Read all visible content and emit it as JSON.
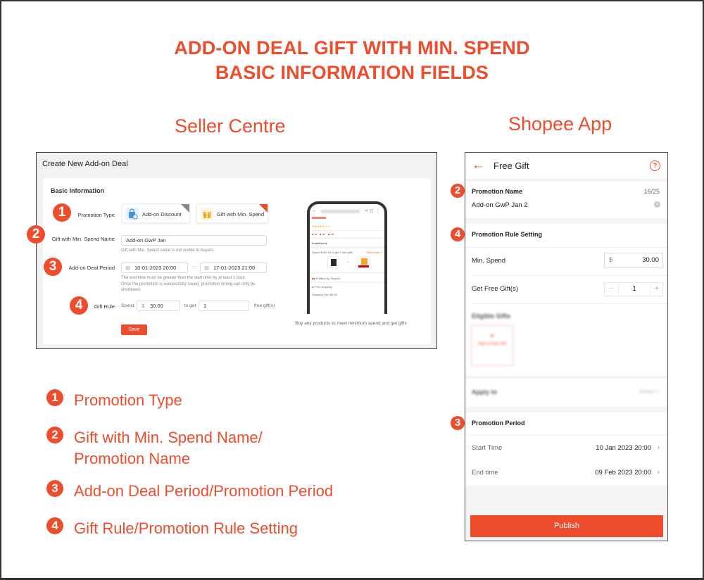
{
  "colors": {
    "accent": "#ee4d2d",
    "text": "#222222",
    "muted": "#888888",
    "panel_bg": "#f2f2f2"
  },
  "header": {
    "title_line1": "ADD-ON DEAL GIFT WITH MIN. SPEND",
    "title_line2": "BASIC INFORMATION FIELDS",
    "seller_heading": "Seller Centre",
    "app_heading": "Shopee App"
  },
  "seller_centre": {
    "page_title": "Create New Add-on Deal",
    "section_title": "Basic Information",
    "promotion_type": {
      "label": "Promotion Type",
      "options": [
        {
          "label": "Add-on Discount",
          "icon": "shopping-bag-icon",
          "selected": false
        },
        {
          "label": "Gift with Min. Spend",
          "icon": "gift-icon",
          "selected": true
        }
      ]
    },
    "name": {
      "label": "Gift with Min. Spend Name",
      "value": "Add-on GwP Jan",
      "hint": "Gift with Min. Spend name is not visible to buyers."
    },
    "period": {
      "label": "Add-on Deal Period",
      "start": "10-01-2023 20:00",
      "separator": "—",
      "end": "17-01-2023 21:00",
      "hint1": "The end time must be greater than the start time by at least 1 hour.",
      "hint2": "Once the promotion is successfully saved, promotion timing can only be shortened."
    },
    "gift_rule": {
      "label": "Gift Rule",
      "spend_label": "Spend",
      "currency": "$",
      "spend_value": "30.00",
      "get_label": "to get",
      "gift_count": "1",
      "suffix": "free gift(s)"
    },
    "save_label": "Save",
    "preview": {
      "caption": "Buy any products to meet minimum spend and get gifts",
      "promo_line": "Spend $150.00 to get 2 free gifts",
      "view_more": "View more >",
      "installment": "Installment",
      "fulfilled": "Fulfilled by Shopee",
      "free_shipping": "Free shipping",
      "shipping_fee": "Shipping Fee: $0.00"
    }
  },
  "app": {
    "title": "Free Gift",
    "back_icon": "arrow-left-icon",
    "help_icon": "question-circle-icon",
    "promotion_name": {
      "label": "Promotion Name",
      "counter": "16/25",
      "value": "Add-on GwP Jan 2"
    },
    "rule_setting": {
      "title": "Promotion Rule Setting",
      "min_spend_label": "Min. Spend",
      "currency": "$",
      "min_spend_value": "30.00",
      "gifts_label": "Get Free Gift(s)",
      "gifts_value": "1",
      "minus": "−",
      "plus": "+"
    },
    "blurred": {
      "eligible_gifts": "Eligible Gifts",
      "add_gift": "Add a Free Gift",
      "apply_to": "Apply to",
      "apply_value": "Select >"
    },
    "period": {
      "title": "Promotion Period",
      "start_label": "Start Time",
      "start_value": "10 Jan 2023 20:00",
      "end_label": "End time",
      "end_value": "09 Feb 2023 20:00"
    },
    "publish_label": "Publish"
  },
  "badges": [
    "1",
    "2",
    "3",
    "4"
  ],
  "legend": [
    {
      "num": "1",
      "text": "Promotion Type"
    },
    {
      "num": "2",
      "text": "Gift with Min. Spend Name/",
      "text2": "Promotion Name"
    },
    {
      "num": "3",
      "text": "Add-on Deal Period/Promotion Period"
    },
    {
      "num": "4",
      "text": "Gift Rule/Promotion Rule Setting"
    }
  ]
}
